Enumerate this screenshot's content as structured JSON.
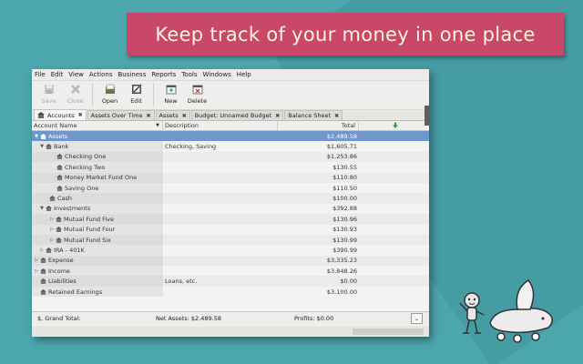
{
  "banner": {
    "text": "Keep track of your money in one place"
  },
  "menu": [
    "File",
    "Edit",
    "View",
    "Actions",
    "Business",
    "Reports",
    "Tools",
    "Windows",
    "Help"
  ],
  "toolbar": {
    "save": "Save",
    "close": "Close",
    "open": "Open",
    "edit": "Edit",
    "new": "New",
    "delete": "Delete"
  },
  "tabs": [
    "Accounts",
    "Assets Over Time",
    "Assets",
    "Budget: Unnamed Budget",
    "Balance Sheet"
  ],
  "columns": {
    "name": "Account Name",
    "description": "Description",
    "total": "Total"
  },
  "accounts": [
    {
      "name": "Assets",
      "description": "",
      "total": "$2,489.58"
    },
    {
      "name": "Bank",
      "description": "Checking, Saving",
      "total": "$1,605.71"
    },
    {
      "name": "Checking One",
      "description": "",
      "total": "$1,253.86"
    },
    {
      "name": "Checking Two",
      "description": "",
      "total": "$130.55"
    },
    {
      "name": "Money Market Fund One",
      "description": "",
      "total": "$110.80"
    },
    {
      "name": "Saving One",
      "description": "",
      "total": "$110.50"
    },
    {
      "name": "Cash",
      "description": "",
      "total": "$100.00"
    },
    {
      "name": "Investments",
      "description": "",
      "total": "$392.88"
    },
    {
      "name": "Mutual Fund Five",
      "description": "",
      "total": "$130.96"
    },
    {
      "name": "Mutual Fund Four",
      "description": "",
      "total": "$130.93"
    },
    {
      "name": "Mutual Fund Six",
      "description": "",
      "total": "$130.99"
    },
    {
      "name": "IRA - 401K",
      "description": "",
      "total": "$390.99"
    },
    {
      "name": "Expense",
      "description": "",
      "total": "$3,335.23"
    },
    {
      "name": "Income",
      "description": "",
      "total": "$3,848.26"
    },
    {
      "name": "Liabilities",
      "description": "Loans, etc.",
      "total": "$0.00"
    },
    {
      "name": "Retained Earnings",
      "description": "",
      "total": "$3,100.00"
    }
  ],
  "footer": {
    "grand_total": "$, Grand Total:",
    "net_assets": "Net Assets: $2,489.58",
    "profits": "Profits: $0.00"
  },
  "colors": {
    "banner": "#c9486a",
    "background": "#4ca6ae",
    "selection": "#6f97cc"
  }
}
